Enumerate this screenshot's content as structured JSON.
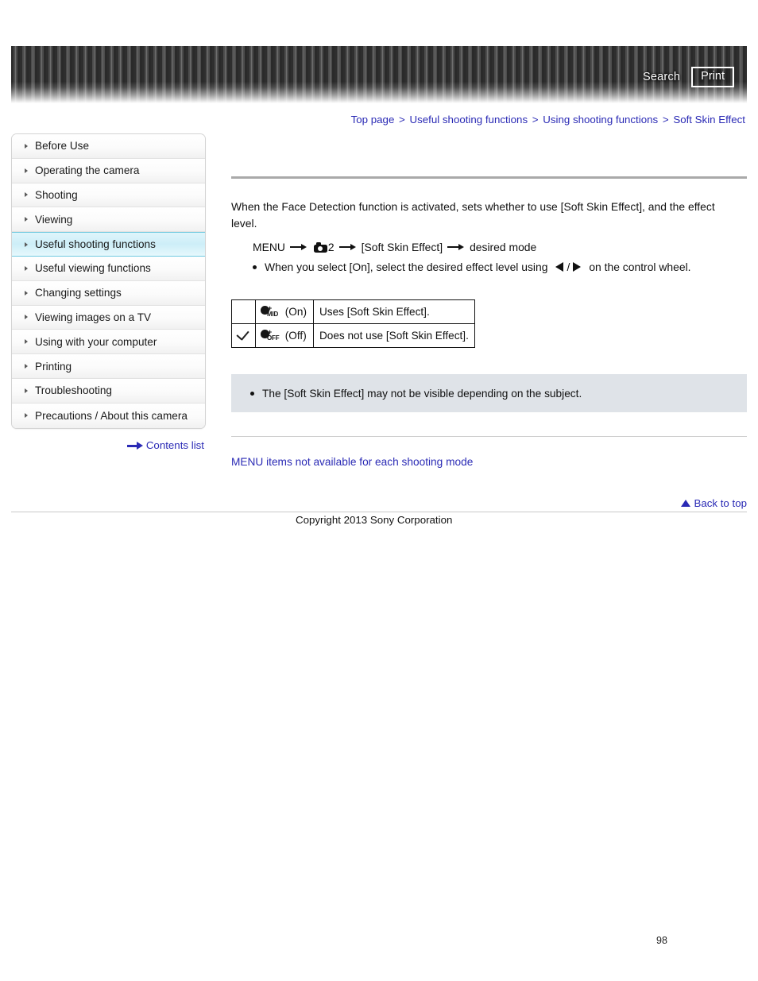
{
  "header": {
    "search_label": "Search",
    "print_label": "Print"
  },
  "breadcrumb": {
    "separator": ">",
    "items": [
      "Top page",
      "Useful shooting functions",
      "Using shooting functions",
      "Soft Skin Effect"
    ]
  },
  "sidebar": {
    "items": [
      {
        "label": "Before Use",
        "active": false
      },
      {
        "label": "Operating the camera",
        "active": false
      },
      {
        "label": "Shooting",
        "active": false
      },
      {
        "label": "Viewing",
        "active": false
      },
      {
        "label": "Useful shooting functions",
        "active": true
      },
      {
        "label": "Useful viewing functions",
        "active": false
      },
      {
        "label": "Changing settings",
        "active": false
      },
      {
        "label": "Viewing images on a TV",
        "active": false
      },
      {
        "label": "Using with your computer",
        "active": false
      },
      {
        "label": "Printing",
        "active": false
      },
      {
        "label": "Troubleshooting",
        "active": false
      },
      {
        "label": "Precautions / About this camera",
        "active": false
      }
    ],
    "contents_list_label": "Contents list"
  },
  "main": {
    "intro": "When the Face Detection function is activated, sets whether to use [Soft Skin Effect], and the effect level.",
    "menu_path": {
      "menu_label": "MENU",
      "tab_number": "2",
      "setting_label": "[Soft Skin Effect]",
      "target_label": "desired mode"
    },
    "bullet": {
      "text_before": "When you select [On], select the desired effect level using",
      "separator": "/",
      "text_after": "on the control wheel."
    },
    "table": {
      "rows": [
        {
          "checked": false,
          "icon_level": "MID",
          "icon_label": "(On)",
          "description": "Uses [Soft Skin Effect]."
        },
        {
          "checked": true,
          "icon_level": "OFF",
          "icon_label": "(Off)",
          "description": "Does not use [Soft Skin Effect]."
        }
      ]
    },
    "note": "The [Soft Skin Effect] may not be visible depending on the subject.",
    "related_link": "MENU items not available for each shooting mode"
  },
  "footer": {
    "back_to_top": "Back to top",
    "copyright": "Copyright 2013 Sony Corporation",
    "page_number": "98"
  },
  "colors": {
    "link": "#2a2ab5",
    "active_sidebar": "#cdeef8",
    "note_background": "#dfe3e8",
    "header_dark": "#2e2e2e"
  }
}
